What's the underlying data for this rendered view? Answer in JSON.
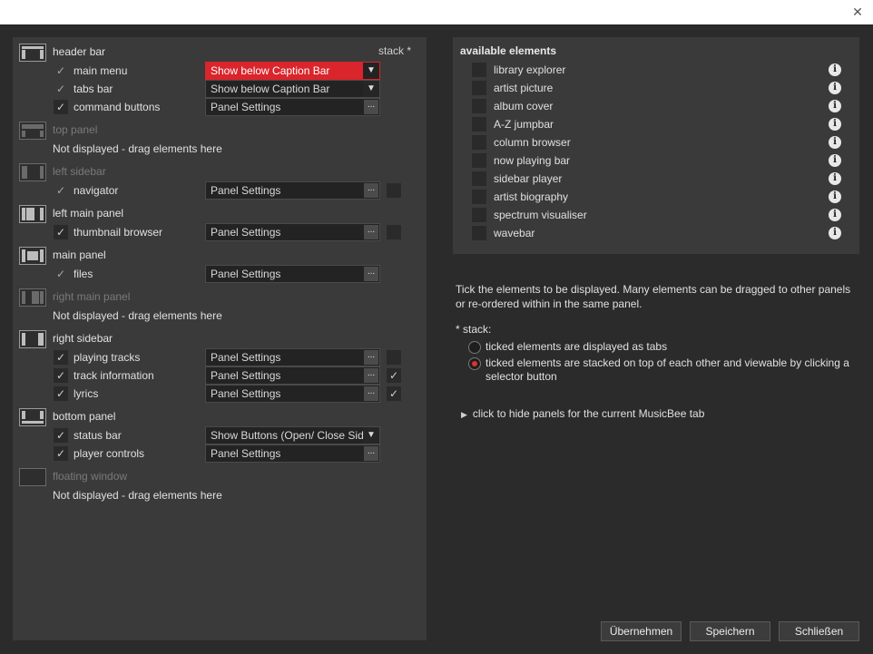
{
  "window": {
    "close_glyph": "✕"
  },
  "layout": {
    "stack_header": "stack *",
    "not_displayed": "Not displayed - drag elements here",
    "sections": {
      "header_bar": {
        "label": "header bar",
        "items": [
          {
            "label": "main menu",
            "value": "Show below Caption Bar"
          },
          {
            "label": "tabs bar",
            "value": "Show below Caption Bar"
          },
          {
            "label": "command buttons",
            "value": "Panel Settings"
          }
        ]
      },
      "top_panel": {
        "label": "top panel"
      },
      "left_sidebar": {
        "label": "left sidebar",
        "items": [
          {
            "label": "navigator",
            "value": "Panel Settings"
          }
        ]
      },
      "left_main_panel": {
        "label": "left main panel",
        "items": [
          {
            "label": "thumbnail browser",
            "value": "Panel Settings"
          }
        ]
      },
      "main_panel": {
        "label": "main panel",
        "items": [
          {
            "label": "files",
            "value": "Panel Settings"
          }
        ]
      },
      "right_main_panel": {
        "label": "right main panel"
      },
      "right_sidebar": {
        "label": "right sidebar",
        "items": [
          {
            "label": "playing tracks",
            "value": "Panel Settings",
            "stacked": false
          },
          {
            "label": "track information",
            "value": "Panel Settings",
            "stacked": true
          },
          {
            "label": "lyrics",
            "value": "Panel Settings",
            "stacked": true
          }
        ]
      },
      "bottom_panel": {
        "label": "bottom panel",
        "items": [
          {
            "label": "status bar",
            "value": "Show Buttons (Open/ Close Side"
          },
          {
            "label": "player controls",
            "value": "Panel Settings"
          }
        ]
      },
      "floating_window": {
        "label": "floating window"
      }
    },
    "dots": "...",
    "arrow": "▼",
    "check": "✓"
  },
  "available": {
    "title": "available elements",
    "items": [
      "library explorer",
      "artist picture",
      "album cover",
      "A-Z jumpbar",
      "column browser",
      "now playing bar",
      "sidebar player",
      "artist biography",
      "spectrum visualiser",
      "wavebar"
    ],
    "info_glyph": "i"
  },
  "help": {
    "text": "Tick the elements to be displayed. Many elements can be dragged to other panels or re-ordered within in the same panel.",
    "stack_label": "* stack:",
    "option_tabs": "ticked elements are displayed as tabs",
    "option_stacked": "ticked elements are stacked on top of each other and viewable by clicking a selector button",
    "hide_link": "click to hide panels for the current MusicBee tab",
    "triangle": "▶"
  },
  "buttons": {
    "apply": "Übernehmen",
    "save": "Speichern",
    "close": "Schließen"
  },
  "colors": {
    "accent": "#d9252b",
    "panel": "#3a3a3a",
    "background": "#2b2b2b"
  }
}
